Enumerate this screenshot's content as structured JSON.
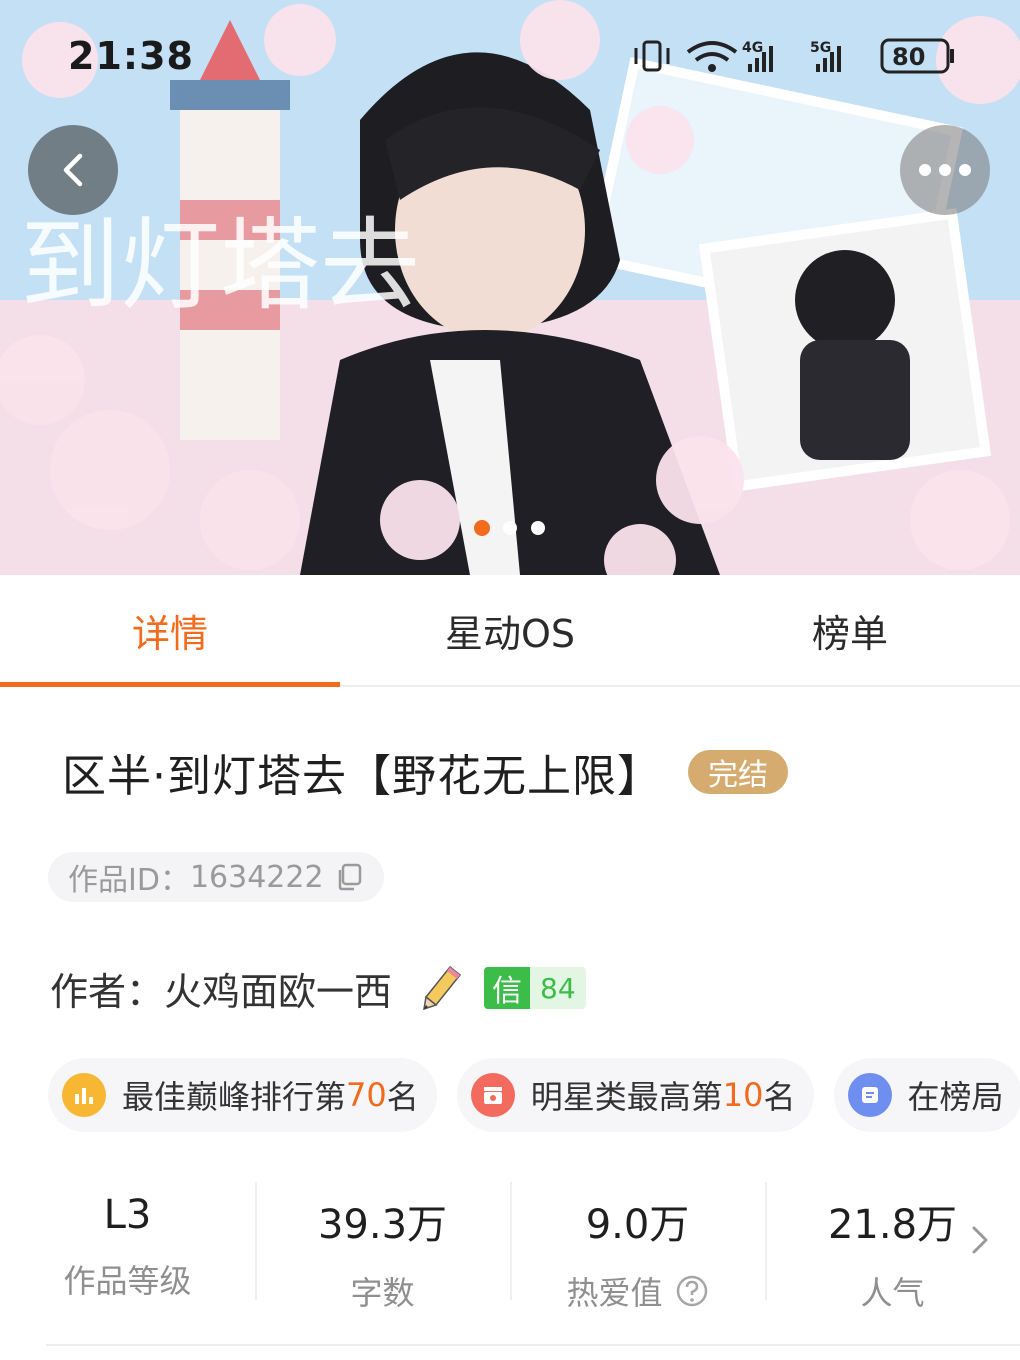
{
  "status_bar": {
    "time": "21:38",
    "network_a": "4G",
    "network_b": "5G",
    "battery": "80",
    "icons": [
      "vibrate-icon",
      "wifi-icon",
      "signal-icon",
      "signal-icon",
      "battery-icon"
    ]
  },
  "banner": {
    "cover_title": "到灯塔去",
    "pages": 3,
    "active_page": 1
  },
  "tabs": [
    {
      "label": "详情",
      "active": true
    },
    {
      "label": "星动OS",
      "active": false
    },
    {
      "label": "榜单",
      "active": false
    }
  ],
  "work": {
    "title": "区半·到灯塔去【野花无上限】",
    "status": "完结",
    "id_label": "作品ID：",
    "id_value": "1634222",
    "author_label": "作者：",
    "author_name": "火鸡面欧一西",
    "credit_mark": "信",
    "credit_score": "84"
  },
  "rank_chips": [
    {
      "prefix": "最佳巅峰排行第",
      "number": "70",
      "suffix": "名",
      "icon": "bar-chart-icon",
      "color": "#f7b733"
    },
    {
      "prefix": "明星类最高第",
      "number": "10",
      "suffix": "名",
      "icon": "clapperboard-icon",
      "color": "#f36b5e"
    },
    {
      "prefix": "在榜局",
      "number": "",
      "suffix": "",
      "icon": "list-icon",
      "color": "#6e8ff0"
    }
  ],
  "stats": [
    {
      "value": "L3",
      "label": "作品等级"
    },
    {
      "value": "39.3万",
      "label": "字数"
    },
    {
      "value": "9.0万",
      "label": "热爱值"
    },
    {
      "value": "21.8万",
      "label": "人气"
    }
  ],
  "colors": {
    "accent": "#f26a1b",
    "badge": "#d6ab6f",
    "credit": "#3cbd4a"
  }
}
